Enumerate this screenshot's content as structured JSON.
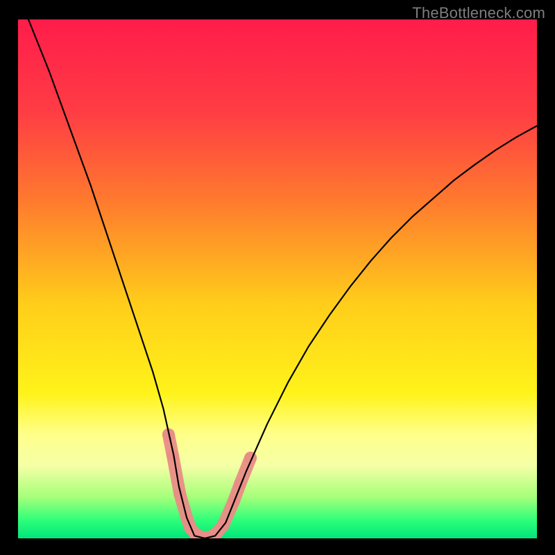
{
  "watermark": "TheBottleneck.com",
  "chart_data": {
    "type": "line",
    "title": "",
    "xlabel": "",
    "ylabel": "",
    "xlim": [
      0,
      100
    ],
    "ylim": [
      0,
      100
    ],
    "background_gradient": {
      "stops": [
        {
          "offset": 0.0,
          "color": "#ff1c4b"
        },
        {
          "offset": 0.18,
          "color": "#ff3d44"
        },
        {
          "offset": 0.35,
          "color": "#ff7a2e"
        },
        {
          "offset": 0.55,
          "color": "#ffce1a"
        },
        {
          "offset": 0.72,
          "color": "#fff31a"
        },
        {
          "offset": 0.8,
          "color": "#ffff8a"
        },
        {
          "offset": 0.86,
          "color": "#f5ffa6"
        },
        {
          "offset": 0.92,
          "color": "#a6ff7a"
        },
        {
          "offset": 0.965,
          "color": "#2eff7a"
        },
        {
          "offset": 1.0,
          "color": "#00e57a"
        }
      ]
    },
    "series": [
      {
        "name": "curve",
        "stroke": "#000000",
        "stroke_width": 2.2,
        "x": [
          2,
          4,
          6,
          8,
          10,
          12,
          14,
          16,
          18,
          20,
          22,
          24,
          26,
          28,
          30,
          31,
          32.5,
          34,
          36,
          38,
          40,
          42,
          44,
          48,
          52,
          56,
          60,
          64,
          68,
          72,
          76,
          80,
          84,
          88,
          92,
          96,
          100
        ],
        "y": [
          100,
          95,
          90,
          84.5,
          79,
          73.5,
          68,
          62,
          56,
          50,
          44,
          38,
          32,
          25,
          16,
          10,
          4,
          0.5,
          0,
          0.5,
          3,
          8,
          13,
          22,
          30,
          37,
          43,
          48.5,
          53.5,
          58,
          62,
          65.5,
          69,
          72,
          74.8,
          77.3,
          79.5
        ]
      }
    ],
    "markers": {
      "name": "highlight-segment",
      "fill": "#e98d87",
      "stroke": "#e98d87",
      "radius": 9,
      "points": [
        {
          "x": 29.0,
          "y": 20.0
        },
        {
          "x": 29.8,
          "y": 16.0
        },
        {
          "x": 31.2,
          "y": 8.5
        },
        {
          "x": 32.5,
          "y": 4.0
        },
        {
          "x": 33.2,
          "y": 2.0
        },
        {
          "x": 34.3,
          "y": 0.7
        },
        {
          "x": 35.5,
          "y": 0.2
        },
        {
          "x": 36.8,
          "y": 0.2
        },
        {
          "x": 38.0,
          "y": 0.7
        },
        {
          "x": 39.5,
          "y": 2.5
        },
        {
          "x": 41.5,
          "y": 7.0
        },
        {
          "x": 42.8,
          "y": 10.5
        },
        {
          "x": 44.8,
          "y": 15.5
        }
      ]
    }
  }
}
